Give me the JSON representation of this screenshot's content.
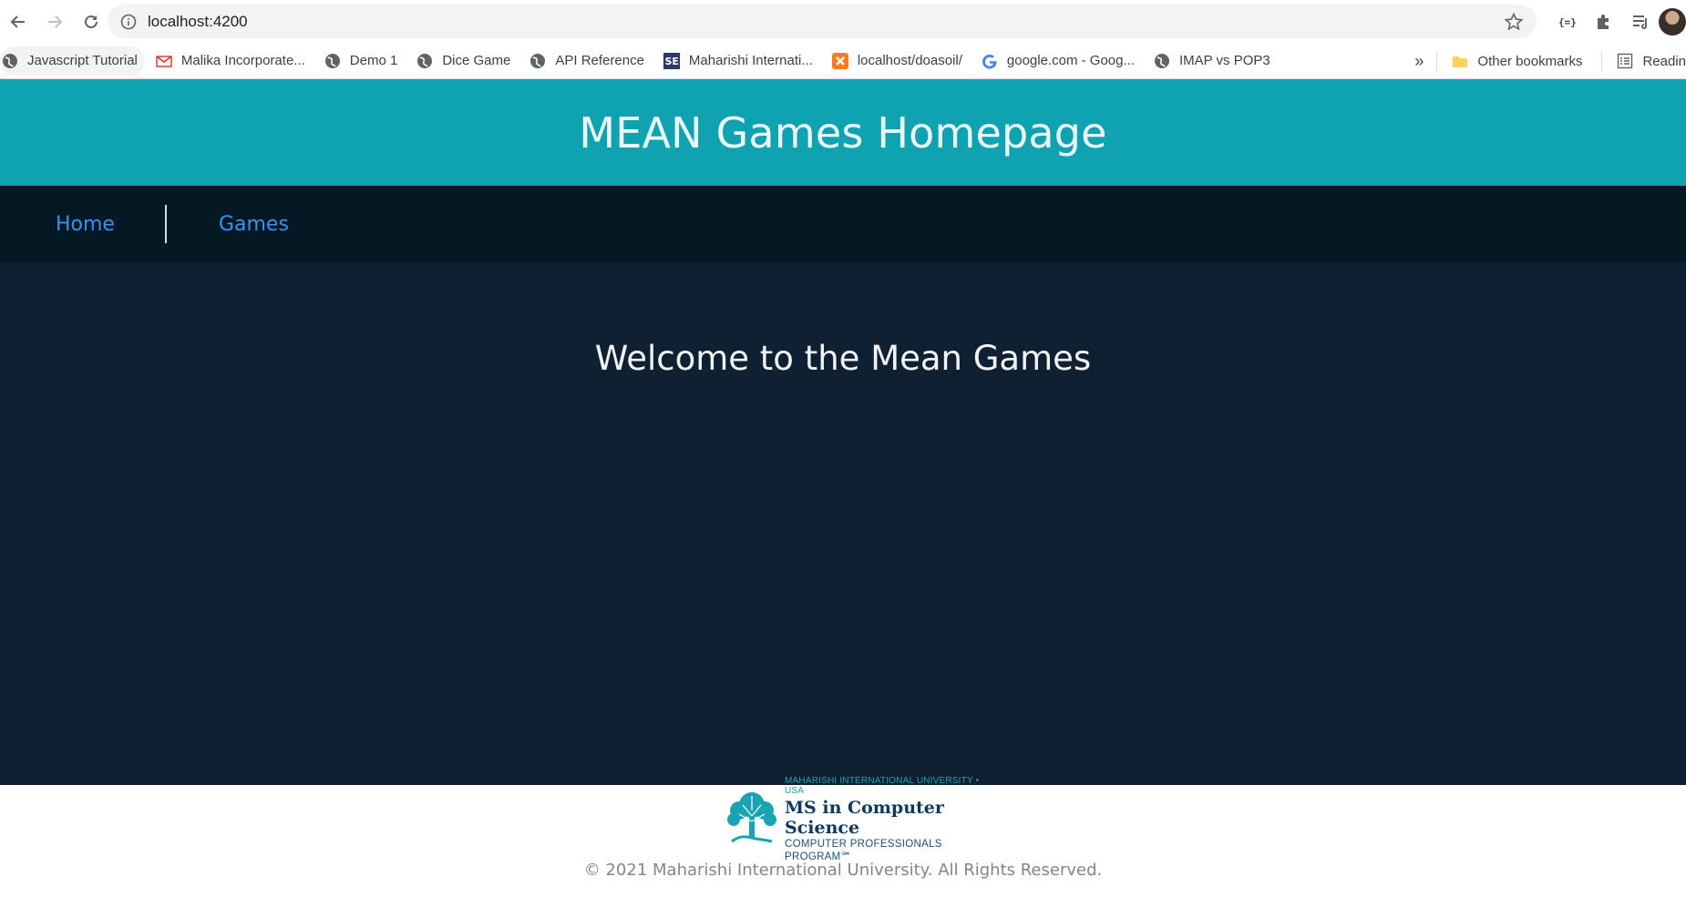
{
  "browser": {
    "url": "localhost:4200",
    "bookmarks": [
      {
        "label": "Javascript Tutorial",
        "icon": "globe-icon"
      },
      {
        "label": "Malika Incorporate...",
        "icon": "gmail-icon"
      },
      {
        "label": "Demo 1",
        "icon": "globe-icon"
      },
      {
        "label": "Dice Game",
        "icon": "globe-icon"
      },
      {
        "label": "API Reference",
        "icon": "globe-icon"
      },
      {
        "label": "Maharishi Internati...",
        "icon": "se-icon"
      },
      {
        "label": "localhost/doasoil/",
        "icon": "xampp-icon"
      },
      {
        "label": "google.com - Goog...",
        "icon": "google-icon"
      },
      {
        "label": "IMAP vs POP3",
        "icon": "globe-icon"
      }
    ],
    "more_label": "»",
    "other_bookmarks": "Other bookmarks",
    "reading_list": "Readin"
  },
  "page": {
    "title": "MEAN Games Homepage",
    "nav": {
      "home": "Home",
      "games": "Games"
    },
    "welcome": "Welcome to the Mean Games"
  },
  "footer": {
    "logo": {
      "top": "MAHARISHI INTERNATIONAL UNIVERSITY • USA",
      "mid": "MS in Computer Science",
      "bot": "COMPUTER PROFESSIONALS PROGRAM℠"
    },
    "copyright": "© 2021 Maharishi International University. All Rights Reserved."
  },
  "colors": {
    "header": "#0fa3b1",
    "navbar": "#041923",
    "main": "#0f2033",
    "link": "#3d8ff0"
  }
}
